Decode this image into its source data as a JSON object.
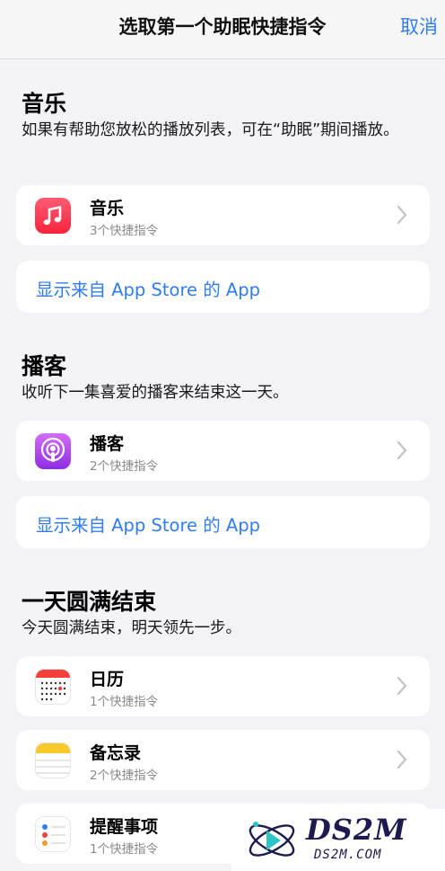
{
  "header": {
    "title": "选取第一个助眠快捷指令",
    "cancel_label": "取消"
  },
  "sections": [
    {
      "title": "音乐",
      "description": "如果有帮助您放松的播放列表，可在“助眠”期间播放。",
      "apps": [
        {
          "name": "音乐",
          "shortcut_count": "3个快捷指令",
          "icon": "music-icon"
        }
      ],
      "link_label": "显示来自 App Store 的 App"
    },
    {
      "title": "播客",
      "description": "收听下一集喜爱的播客来结束这一天。",
      "apps": [
        {
          "name": "播客",
          "shortcut_count": "2个快捷指令",
          "icon": "podcast-icon"
        }
      ],
      "link_label": "显示来自 App Store 的 App"
    },
    {
      "title": "一天圆满结束",
      "description": "今天圆满结束，明天领先一步。",
      "apps": [
        {
          "name": "日历",
          "shortcut_count": "1个快捷指令",
          "icon": "calendar-icon"
        },
        {
          "name": "备忘录",
          "shortcut_count": "2个快捷指令",
          "icon": "notes-icon"
        },
        {
          "name": "提醒事项",
          "shortcut_count": "1个快捷指令",
          "icon": "reminders-icon"
        }
      ]
    }
  ],
  "watermark": {
    "brand": "DS2M",
    "domain": "DS2M.COM"
  },
  "colors": {
    "accent": "#2f7cf6",
    "background": "#f2f2f7",
    "card": "#ffffff",
    "secondary_text": "#8a8a8e"
  }
}
